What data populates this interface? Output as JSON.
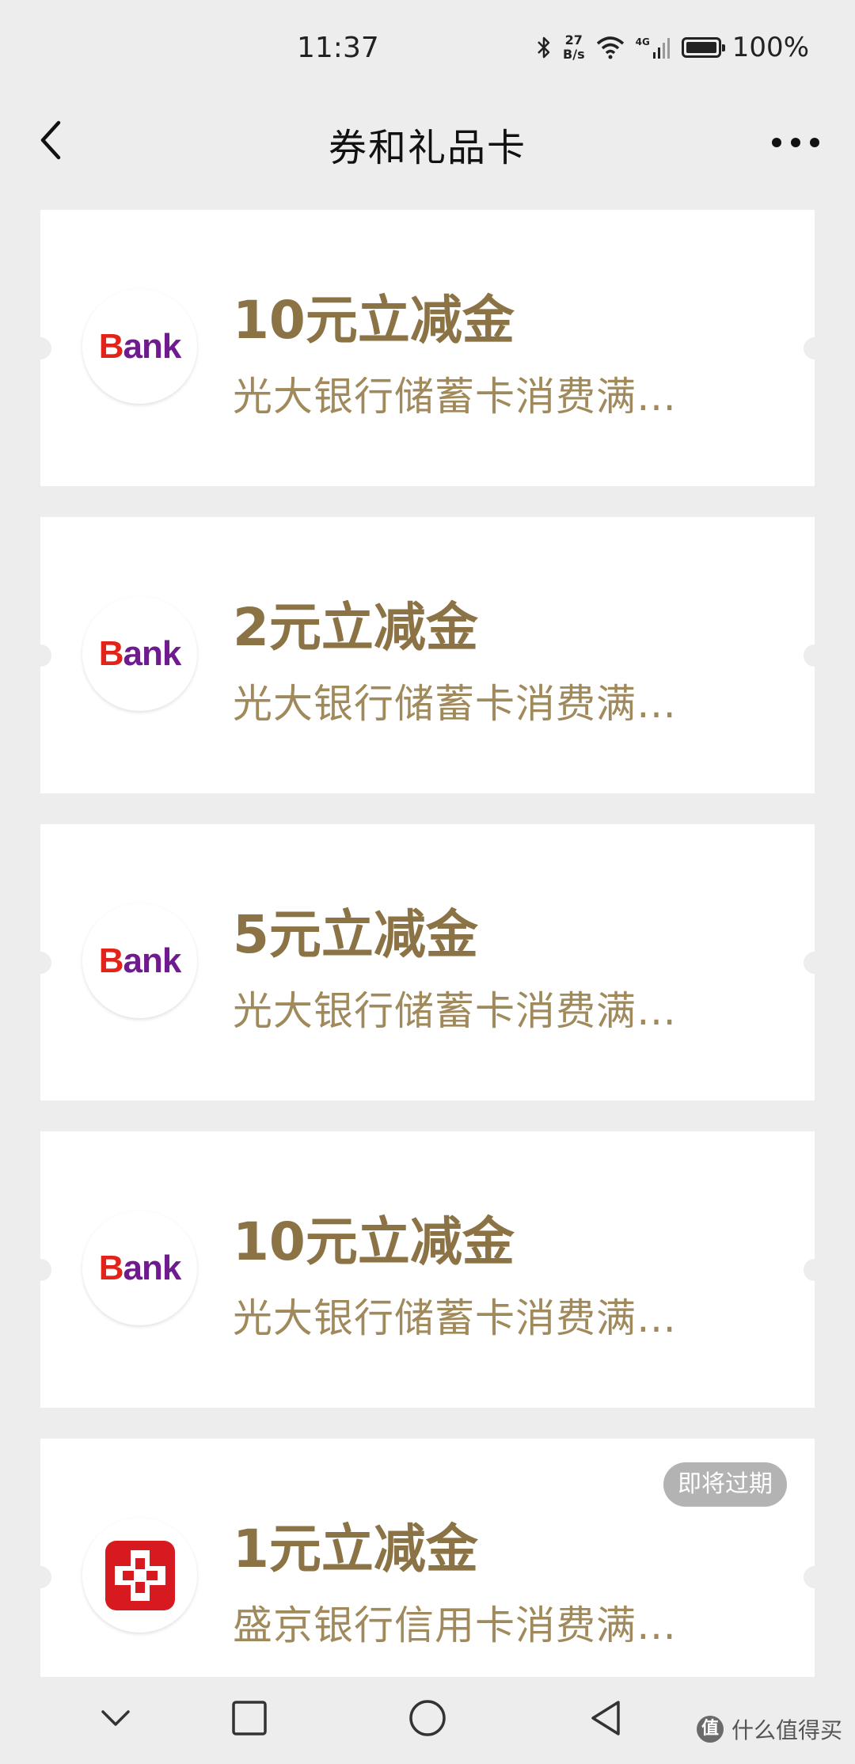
{
  "status_bar": {
    "time": "11:37",
    "net_speed_value": "27",
    "net_speed_unit": "B/s",
    "network_type": "4G",
    "battery_percent": "100%",
    "battery_level": 1.0
  },
  "nav": {
    "title": "券和礼品卡",
    "back_icon": "chevron-left-icon",
    "more_icon": "more-dots-icon"
  },
  "coupons": [
    {
      "title": "10元立减金",
      "desc": "光大银行储蓄卡消费满…",
      "logo_text_b": "B",
      "logo_text_rest": "ank"
    },
    {
      "title": "2元立减金",
      "desc": "光大银行储蓄卡消费满…",
      "logo_text_b": "B",
      "logo_text_rest": "ank"
    },
    {
      "title": "5元立减金",
      "desc": "光大银行储蓄卡消费满…",
      "logo_text_b": "B",
      "logo_text_rest": "ank"
    },
    {
      "title": "10元立减金",
      "desc": "光大银行储蓄卡消费满…",
      "logo_text_b": "B",
      "logo_text_rest": "ank"
    },
    {
      "title": "1元立减金",
      "desc": "盛京银行信用卡消费满…",
      "badge": "即将过期"
    }
  ],
  "watermark": {
    "icon_text": "值",
    "text": "什么值得买"
  },
  "colors": {
    "title_gold": "#8b7346",
    "desc_gold": "#a08a5c",
    "logo_red": "#e2231a",
    "logo_purple": "#6f1a8f",
    "shengjing_red": "#d71920"
  }
}
